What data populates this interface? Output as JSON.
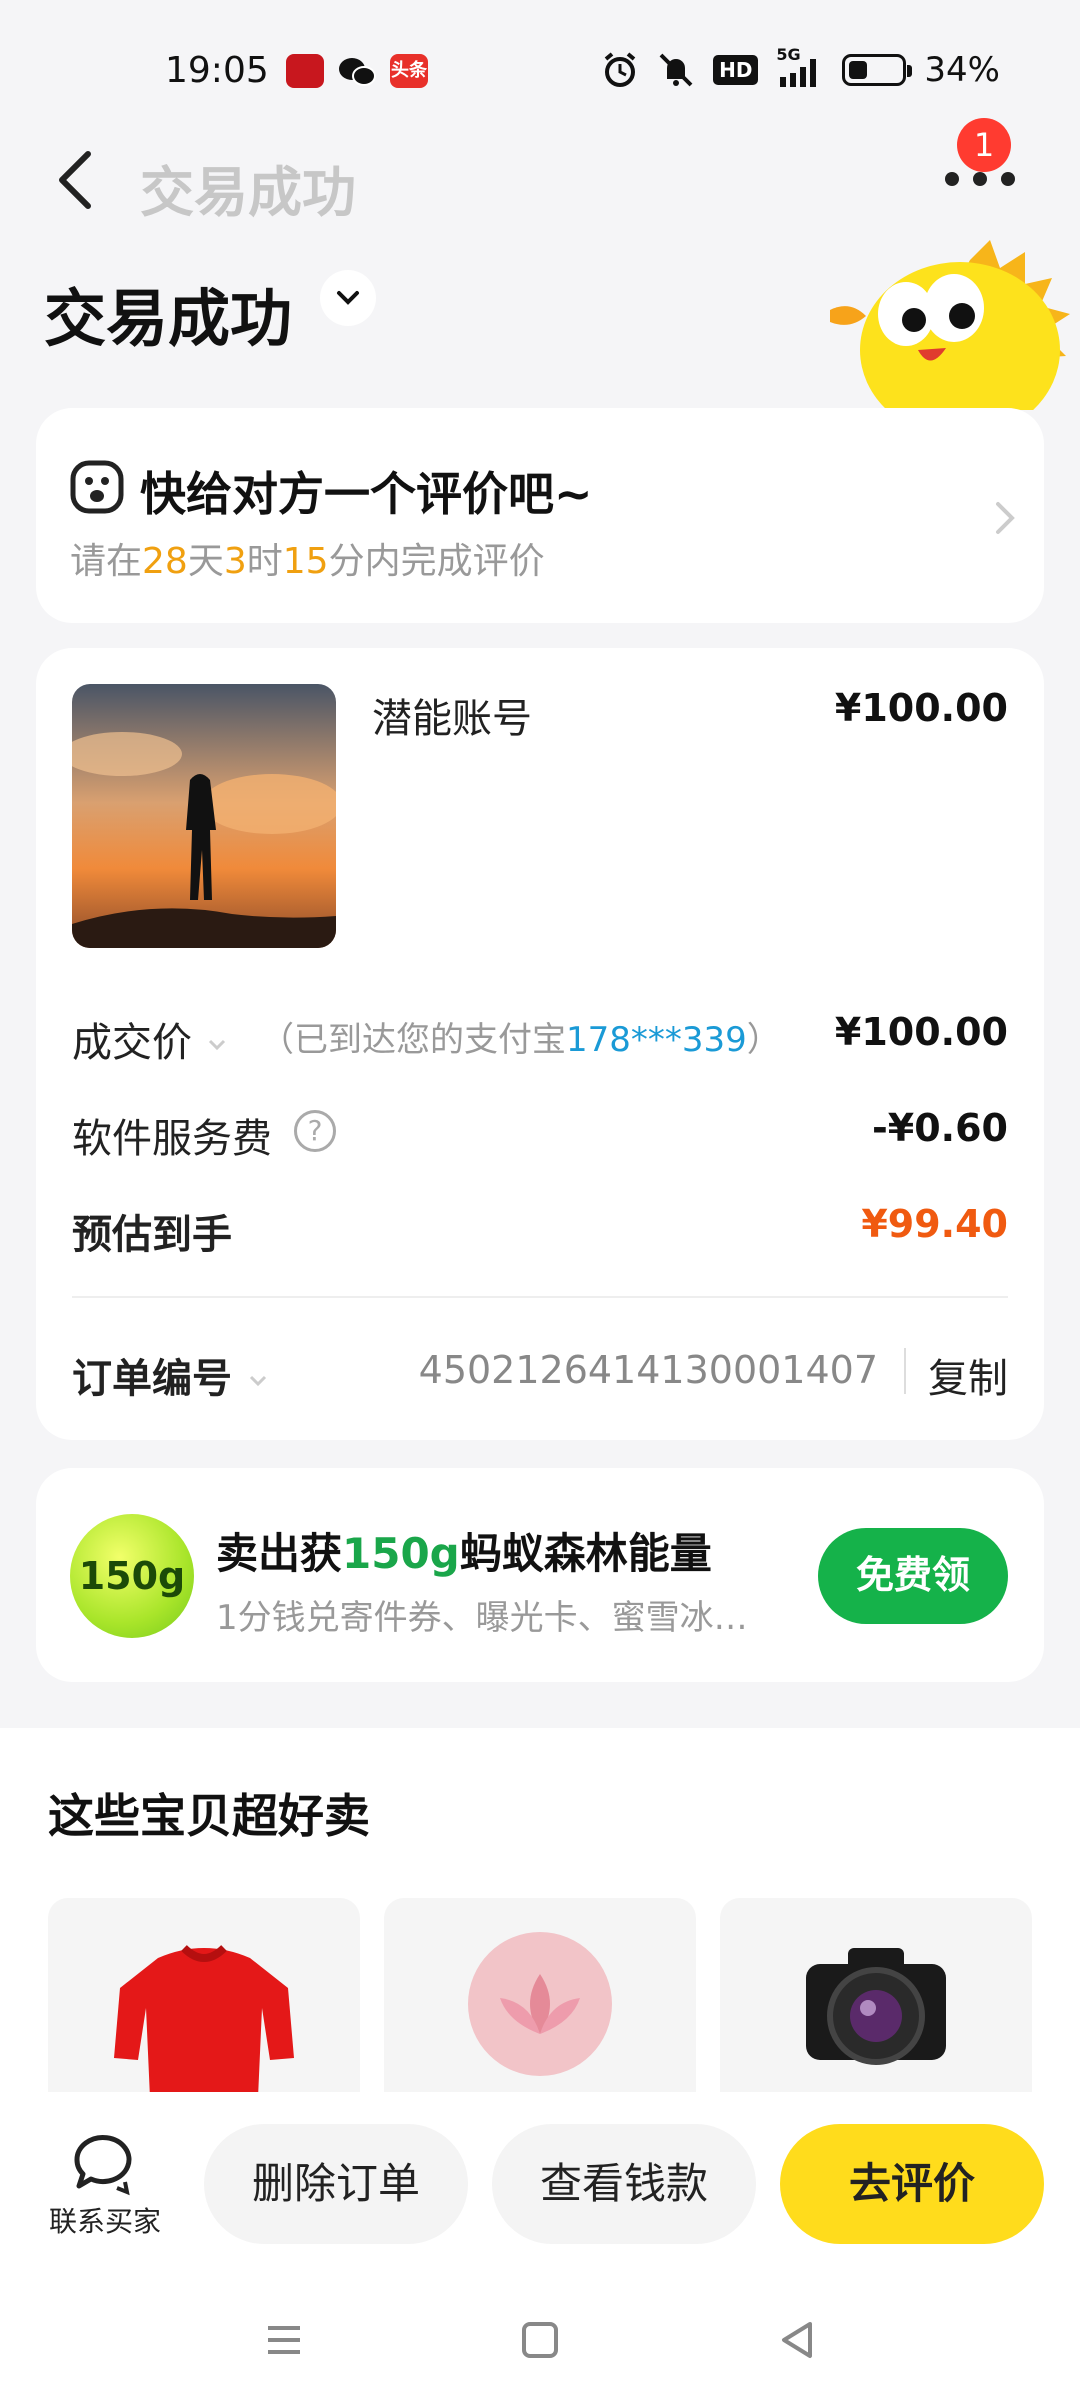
{
  "status_bar": {
    "time": "19:05",
    "battery": "34%",
    "net": "5G",
    "hd": "HD",
    "toutiao": "头条",
    "icons": [
      "alarm-icon",
      "mute-icon",
      "hd-icon",
      "signal-icon",
      "battery-icon"
    ]
  },
  "header": {
    "title": "交易成功",
    "badge_count": "1"
  },
  "page": {
    "title": "交易成功"
  },
  "review_card": {
    "title": "快给对方一个评价吧~",
    "sub_prefix": "请在",
    "days": "28",
    "days_unit": "天",
    "hours": "3",
    "hours_unit": "时",
    "minutes": "15",
    "minutes_unit": "分内完成评价"
  },
  "order": {
    "product_name": "潜能账号",
    "product_price": "¥100.00",
    "deal_label": "成交价",
    "deal_note_prefix": "（已到达您的支付宝",
    "deal_account": "178***339",
    "deal_note_suffix": "）",
    "deal_value": "¥100.00",
    "fee_label": "软件服务费",
    "fee_value": "-¥0.60",
    "estimate_label": "预估到手",
    "estimate_value": "¥99.40",
    "order_no_label": "订单编号",
    "order_no": "4502126414130001407",
    "copy_label": "复制",
    "help_glyph": "?"
  },
  "energy_card": {
    "badge": "150g",
    "title_prefix": "卖出获",
    "title_amount": "150g",
    "title_suffix": "蚂蚁森林能量",
    "subtitle": "1分钱兑寄件券、曝光卡、蜜雪冰…",
    "button": "免费领"
  },
  "recommend": {
    "title": "这些宝贝超好卖"
  },
  "bottom_bar": {
    "contact_label": "联系买家",
    "delete_label": "删除订单",
    "view_label": "查看钱款",
    "review_label": "去评价"
  },
  "colors": {
    "accent_yellow": "#ffdc1c",
    "highlight_orange": "#f0a010",
    "price_red": "#f05a10",
    "link_blue": "#1a9ad6",
    "green": "#15b24a"
  }
}
